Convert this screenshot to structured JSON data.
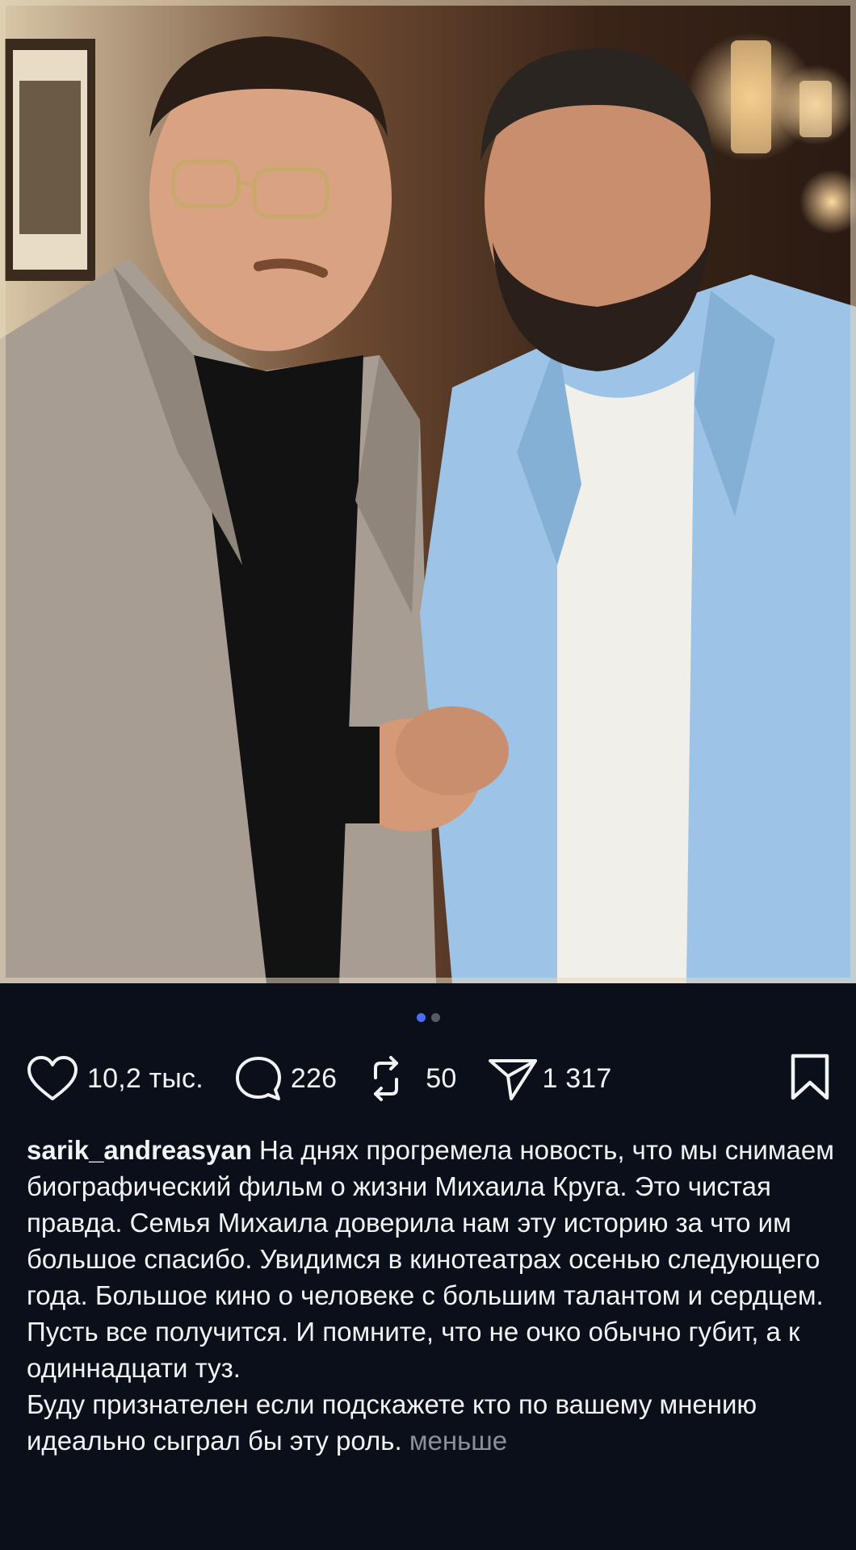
{
  "post": {
    "photo_description": "",
    "carousel": {
      "count": 2,
      "active": 1
    },
    "actions": {
      "likes": "10,2 тыс.",
      "comments": "226",
      "reposts": "50",
      "shares": "1 317"
    },
    "caption": {
      "username": "sarik_andreasyan",
      "text": "На днях прогремела новость, что мы снимаем биографический фильм о жизни Михаила Круга. Это чистая правда. Семья Михаила доверила нам эту историю за что им большое спасибо. Увидимся в кинотеатрах осенью следующего года. Большое кино о человеке с большим талантом и сердцем. Пусть все получится. И помните, что не очко обычно губит, а к одиннадцати туз.",
      "text2": "Буду признателен если подскажете кто по вашему мнению идеально сыграл бы эту роль.",
      "less_label": "меньше"
    }
  },
  "icons": {
    "like": "heart-icon",
    "comment": "comment-bubble-icon",
    "repost": "repost-arrows-icon",
    "share": "send-paper-plane-icon",
    "bookmark": "bookmark-icon"
  },
  "colors": {
    "background": "#0b0f19",
    "text": "#f2f3f5",
    "muted": "#8a8f9c",
    "active_dot": "#4e6ef2"
  }
}
